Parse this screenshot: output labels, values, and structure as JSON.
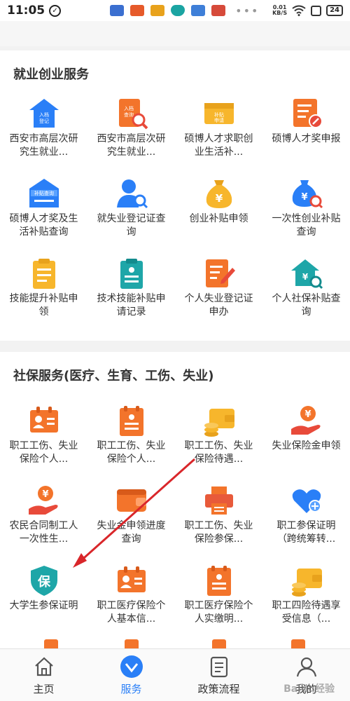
{
  "status_bar": {
    "time": "11:05",
    "speed_top": "0.01",
    "speed_unit": "KB/S",
    "battery": "24"
  },
  "sections": [
    {
      "title": "就业创业服务",
      "items": [
        {
          "label": "西安市高层次研究生就业...",
          "icon": "employment-register-icon",
          "icon_text": "入档登记"
        },
        {
          "label": "西安市高层次研究生就业...",
          "icon": "query-doc-icon",
          "icon_text": "入档查询"
        },
        {
          "label": "硕博人才求职创业生活补...",
          "icon": "subsidy-apply-icon",
          "icon_text": "补贴申请"
        },
        {
          "label": "硕博人才奖申报",
          "icon": "award-apply-icon"
        },
        {
          "label": "硕博人才奖及生活补贴查询",
          "icon": "subsidy-query-icon",
          "icon_text": "补贴查询"
        },
        {
          "label": "就失业登记证查询",
          "icon": "person-search-icon"
        },
        {
          "label": "创业补贴申领",
          "icon": "money-bag-icon"
        },
        {
          "label": "一次性创业补贴查询",
          "icon": "money-bag-search-icon"
        },
        {
          "label": "技能提升补贴申领",
          "icon": "clipboard-icon"
        },
        {
          "label": "技术技能补贴申请记录",
          "icon": "record-list-icon"
        },
        {
          "label": "个人失业登记证申办",
          "icon": "edit-document-icon"
        },
        {
          "label": "个人社保补贴查询",
          "icon": "house-search-icon"
        }
      ]
    },
    {
      "title": "社保服务(医疗、生育、工伤、失业)",
      "items": [
        {
          "label": "职工工伤、失业保险个人...",
          "icon": "id-card-icon"
        },
        {
          "label": "职工工伤、失业保险个人...",
          "icon": "list-card-icon"
        },
        {
          "label": "职工工伤、失业保险待遇...",
          "icon": "wallet-coins-icon"
        },
        {
          "label": "失业保险金申领",
          "icon": "hand-money-icon"
        },
        {
          "label": "农民合同制工人一次性生...",
          "icon": "hand-money-icon"
        },
        {
          "label": "失业金申领进度查询",
          "icon": "wallet-icon"
        },
        {
          "label": "职工工伤、失业保险参保...",
          "icon": "printer-icon"
        },
        {
          "label": "职工参保证明（跨统筹转...",
          "icon": "heart-plus-icon"
        },
        {
          "label": "大学生参保证明",
          "icon": "shield-icon",
          "icon_text": "保"
        },
        {
          "label": "职工医疗保险个人基本信...",
          "icon": "id-card-icon"
        },
        {
          "label": "职工医疗保险个人实缴明...",
          "icon": "list-card-icon"
        },
        {
          "label": "职工四险待遇享受信息（...",
          "icon": "wallet-coins-icon"
        }
      ]
    }
  ],
  "bottom_nav": [
    {
      "label": "主页",
      "icon": "home-icon",
      "active": false
    },
    {
      "label": "服务",
      "icon": "service-icon",
      "active": true
    },
    {
      "label": "政策流程",
      "icon": "policy-doc-icon",
      "active": false
    },
    {
      "label": "我的",
      "icon": "user-icon",
      "active": false
    }
  ],
  "watermark": "Baidu经验",
  "colors": {
    "accent": "#2a7ff7",
    "orange": "#f3742b",
    "yellow": "#f7b62c",
    "teal": "#1ea6a8",
    "annotation": "#d9262a"
  }
}
